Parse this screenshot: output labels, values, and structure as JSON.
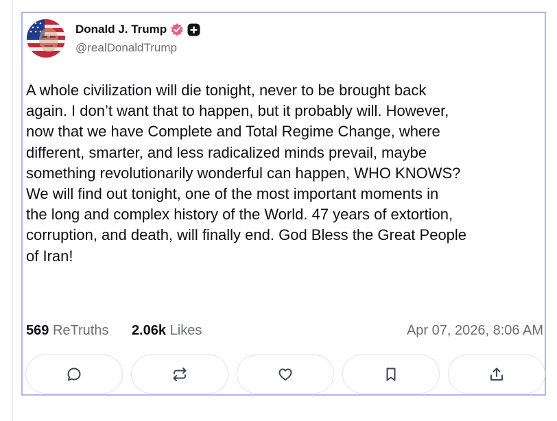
{
  "author": {
    "name": "Donald J. Trump",
    "handle": "@realDonaldTrump",
    "verified_badge_color": "#e8618c"
  },
  "post": {
    "body": "A whole civilization will die tonight, never to be brought back again. I don’t want that to happen, but it probably will. However, now that we have Complete and Total Regime Change, where different, smarter, and less radicalized minds prevail, maybe something revolutionarily wonderful can happen, WHO KNOWS? We will find out tonight, one of the most important moments in the long and complex history of the World. 47 years of extortion, corruption, and death, will finally end. God Bless the Great People of Iran!",
    "body_lines": [
      "A whole civilization will die tonight, never to be brought back",
      "again. I don’t want that to happen, but it probably will. However,",
      "now that we have Complete and Total Regime Change, where",
      "different, smarter, and less radicalized minds prevail, maybe",
      "something revolutionarily wonderful can happen, WHO KNOWS?",
      "We will find out tonight, one of the most important moments in",
      "the long and complex history of the World. 47 years of extortion,",
      "corruption, and death, will finally end. God Bless the Great People",
      "of Iran!"
    ]
  },
  "stats": {
    "retruths_count": "569",
    "retruths_label": "ReTruths",
    "likes_count": "2.06k",
    "likes_label": "Likes",
    "timestamp": "Apr 07, 2026, 8:06 AM"
  },
  "actions": [
    {
      "icon": "reply-icon"
    },
    {
      "icon": "retruth-icon"
    },
    {
      "icon": "like-heart-icon"
    },
    {
      "icon": "bookmark-icon"
    },
    {
      "icon": "share-icon"
    }
  ],
  "colors": {
    "card_border": "#aeb6ee",
    "text_primary": "#0f0f14",
    "text_secondary": "#6c6c78",
    "button_border": "#e2e2e8"
  }
}
